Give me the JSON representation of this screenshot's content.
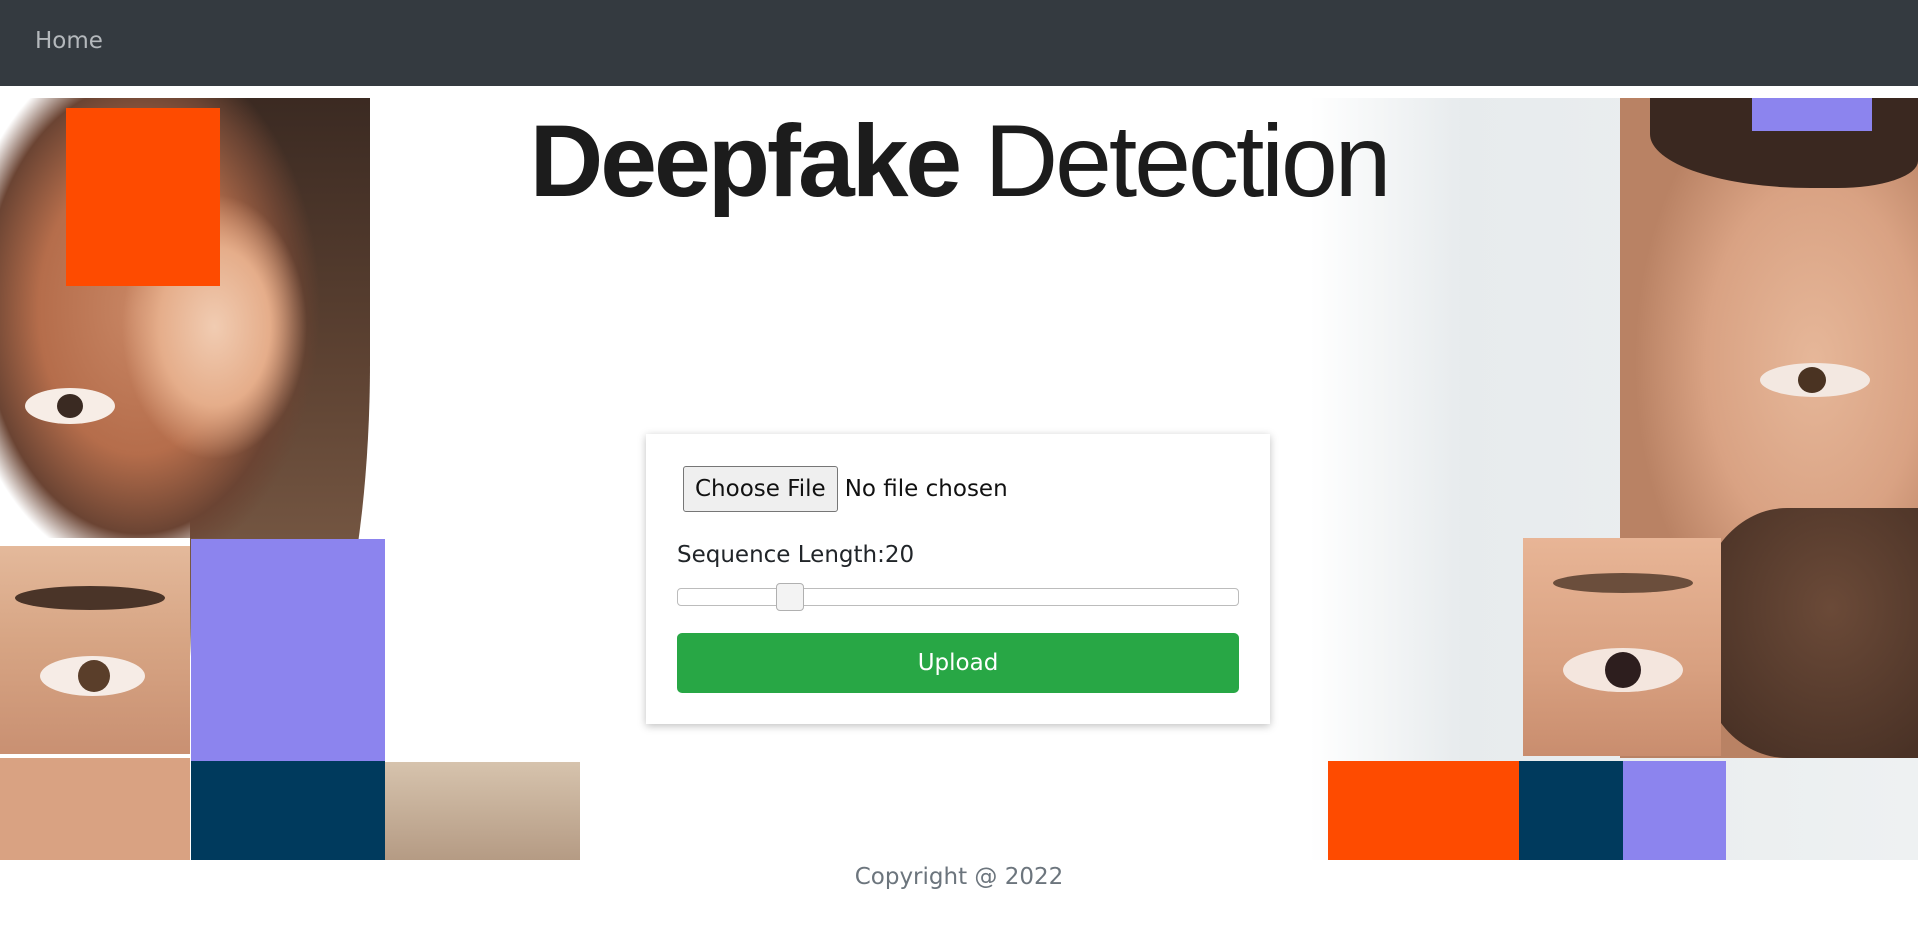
{
  "navbar": {
    "home_label": "Home"
  },
  "hero": {
    "title_bold": "Deepfake",
    "title_light": "Detection"
  },
  "form": {
    "file_button_label": "Choose File",
    "file_status": "No file chosen",
    "sequence_label": "Sequence Length:",
    "sequence_value": "20",
    "slider_fraction": 0.2,
    "upload_label": "Upload"
  },
  "footer": {
    "copyright": "Copyright @ 2022"
  },
  "colors": {
    "navbar_bg": "#343a40",
    "upload_green": "#28a745",
    "accent_orange": "#fe4b00",
    "accent_purple": "#8c84ee",
    "accent_navy": "#003a5d"
  }
}
